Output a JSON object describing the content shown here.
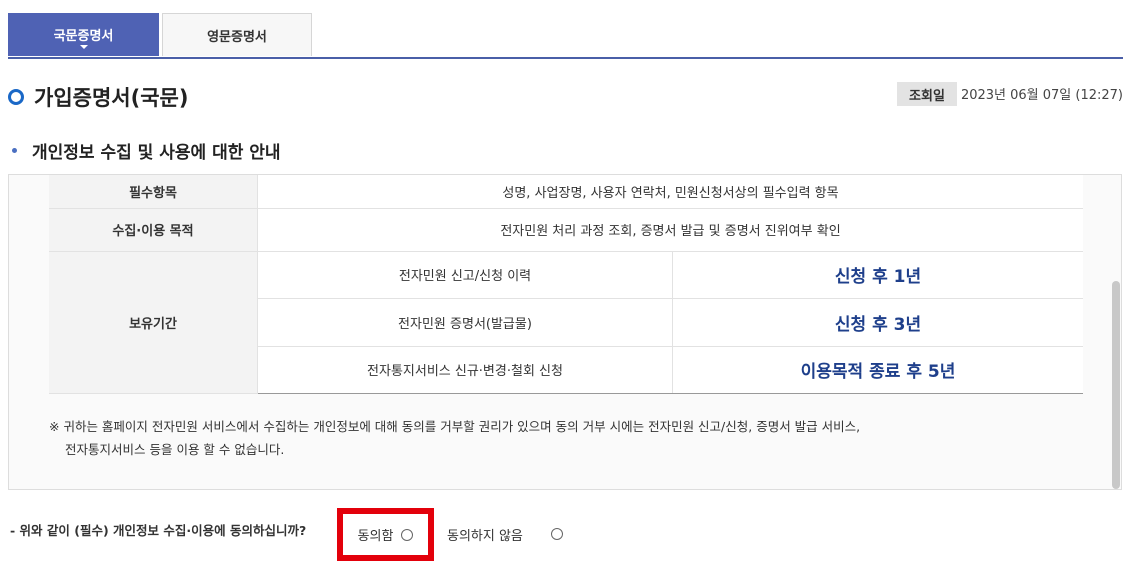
{
  "tabs": [
    {
      "label": "국문증명서",
      "active": true
    },
    {
      "label": "영문증명서",
      "active": false
    }
  ],
  "page": {
    "title": "가입증명서(국문)",
    "view_label": "조회일",
    "view_date": "2023년 06월 07일 (12:27)"
  },
  "section": {
    "title": "개인정보 수집 및 사용에 대한 안내"
  },
  "table": {
    "required_items_label": "필수항목",
    "required_items_value": "성명, 사업장명, 사용자 연락처, 민원신청서상의 필수입력 항목",
    "purpose_label": "수집·이용 목적",
    "purpose_value": "전자민원 처리 과정 조회, 증명서 발급 및 증명서 진위여부 확인",
    "retention_label": "보유기간",
    "retention_rows": [
      {
        "item": "전자민원 신고/신청 이력",
        "period": "신청 후 1년"
      },
      {
        "item": "전자민원 증명서(발급물)",
        "period": "신청 후 3년"
      },
      {
        "item": "전자통지서비스 신규·변경·철회 신청",
        "period": "이용목적 종료 후 5년"
      }
    ]
  },
  "notice": {
    "line1": "※ 귀하는 홈페이지 전자민원 서비스에서 수집하는 개인정보에 대해 동의를 거부할 권리가 있으며 동의 거부 시에는 전자민원 신고/신청, 증명서 발급 서비스,",
    "line2": "전자통지서비스 등을 이용 할 수 없습니다."
  },
  "consent": {
    "question": "- 위와 같이 (필수) 개인정보 수집·이용에 동의하십니까?",
    "agree_label": "동의함",
    "disagree_label": "동의하지 않음"
  },
  "colors": {
    "tab_active": "#4f62b4",
    "accent_blue": "#1a68c7",
    "period_text": "#1e3f8b",
    "highlight": "#e3000b"
  }
}
